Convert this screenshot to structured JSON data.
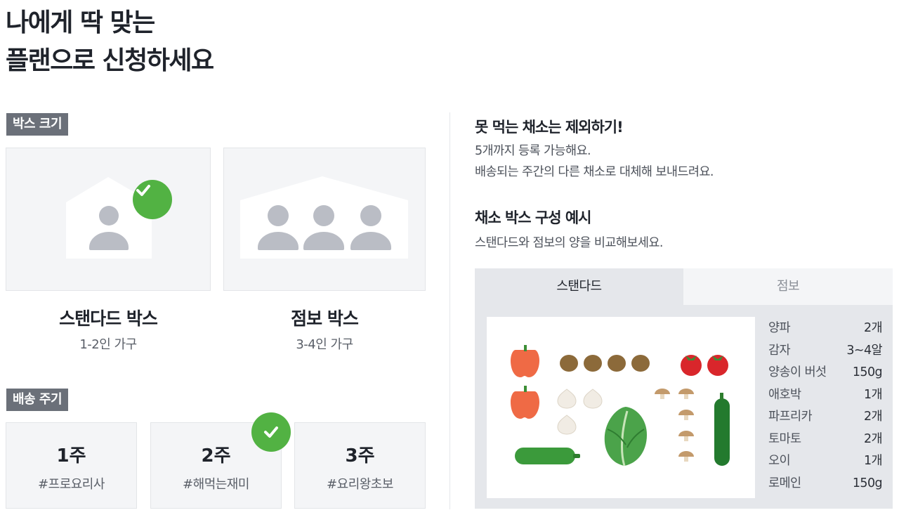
{
  "headline": {
    "line1": "나에게 딱 맞는",
    "line2": "플랜으로 신청하세요"
  },
  "box_size": {
    "label": "박스 크기",
    "options": [
      {
        "title": "스탠다드 박스",
        "subtitle": "1-2인 가구",
        "selected": true
      },
      {
        "title": "점보 박스",
        "subtitle": "3-4인 가구",
        "selected": false
      }
    ]
  },
  "delivery_cycle": {
    "label": "배송 주기",
    "options": [
      {
        "week": "1주",
        "tag": "#프로요리사",
        "selected": false
      },
      {
        "week": "2주",
        "tag": "#해먹는재미",
        "selected": true
      },
      {
        "week": "3주",
        "tag": "#요리왕초보",
        "selected": false
      }
    ]
  },
  "exclude": {
    "title": "못 먹는 채소는 제외하기!",
    "line1": "5개까지 등록 가능해요.",
    "line2": "배송되는 주간의 다른 채소로 대체해 보내드려요."
  },
  "example": {
    "title": "채소 박스 구성 예시",
    "subtitle": "스탠다드와 점보의 양을 비교해보세요.",
    "tabs": [
      "스탠다드",
      "점보"
    ],
    "active_tab": "스탠다드",
    "items": [
      {
        "name": "양파",
        "qty": "2개"
      },
      {
        "name": "감자",
        "qty": "3~4알"
      },
      {
        "name": "양송이 버섯",
        "qty": "150g"
      },
      {
        "name": "애호박",
        "qty": "1개"
      },
      {
        "name": "파프리카",
        "qty": "2개"
      },
      {
        "name": "토마토",
        "qty": "2개"
      },
      {
        "name": "오이",
        "qty": "1개"
      },
      {
        "name": "로메인",
        "qty": "150g"
      }
    ]
  },
  "colors": {
    "check_green": "#52b243",
    "tag_gray": "#6b7079",
    "card_bg": "#f4f5f7",
    "person_gray": "#babdc5"
  }
}
